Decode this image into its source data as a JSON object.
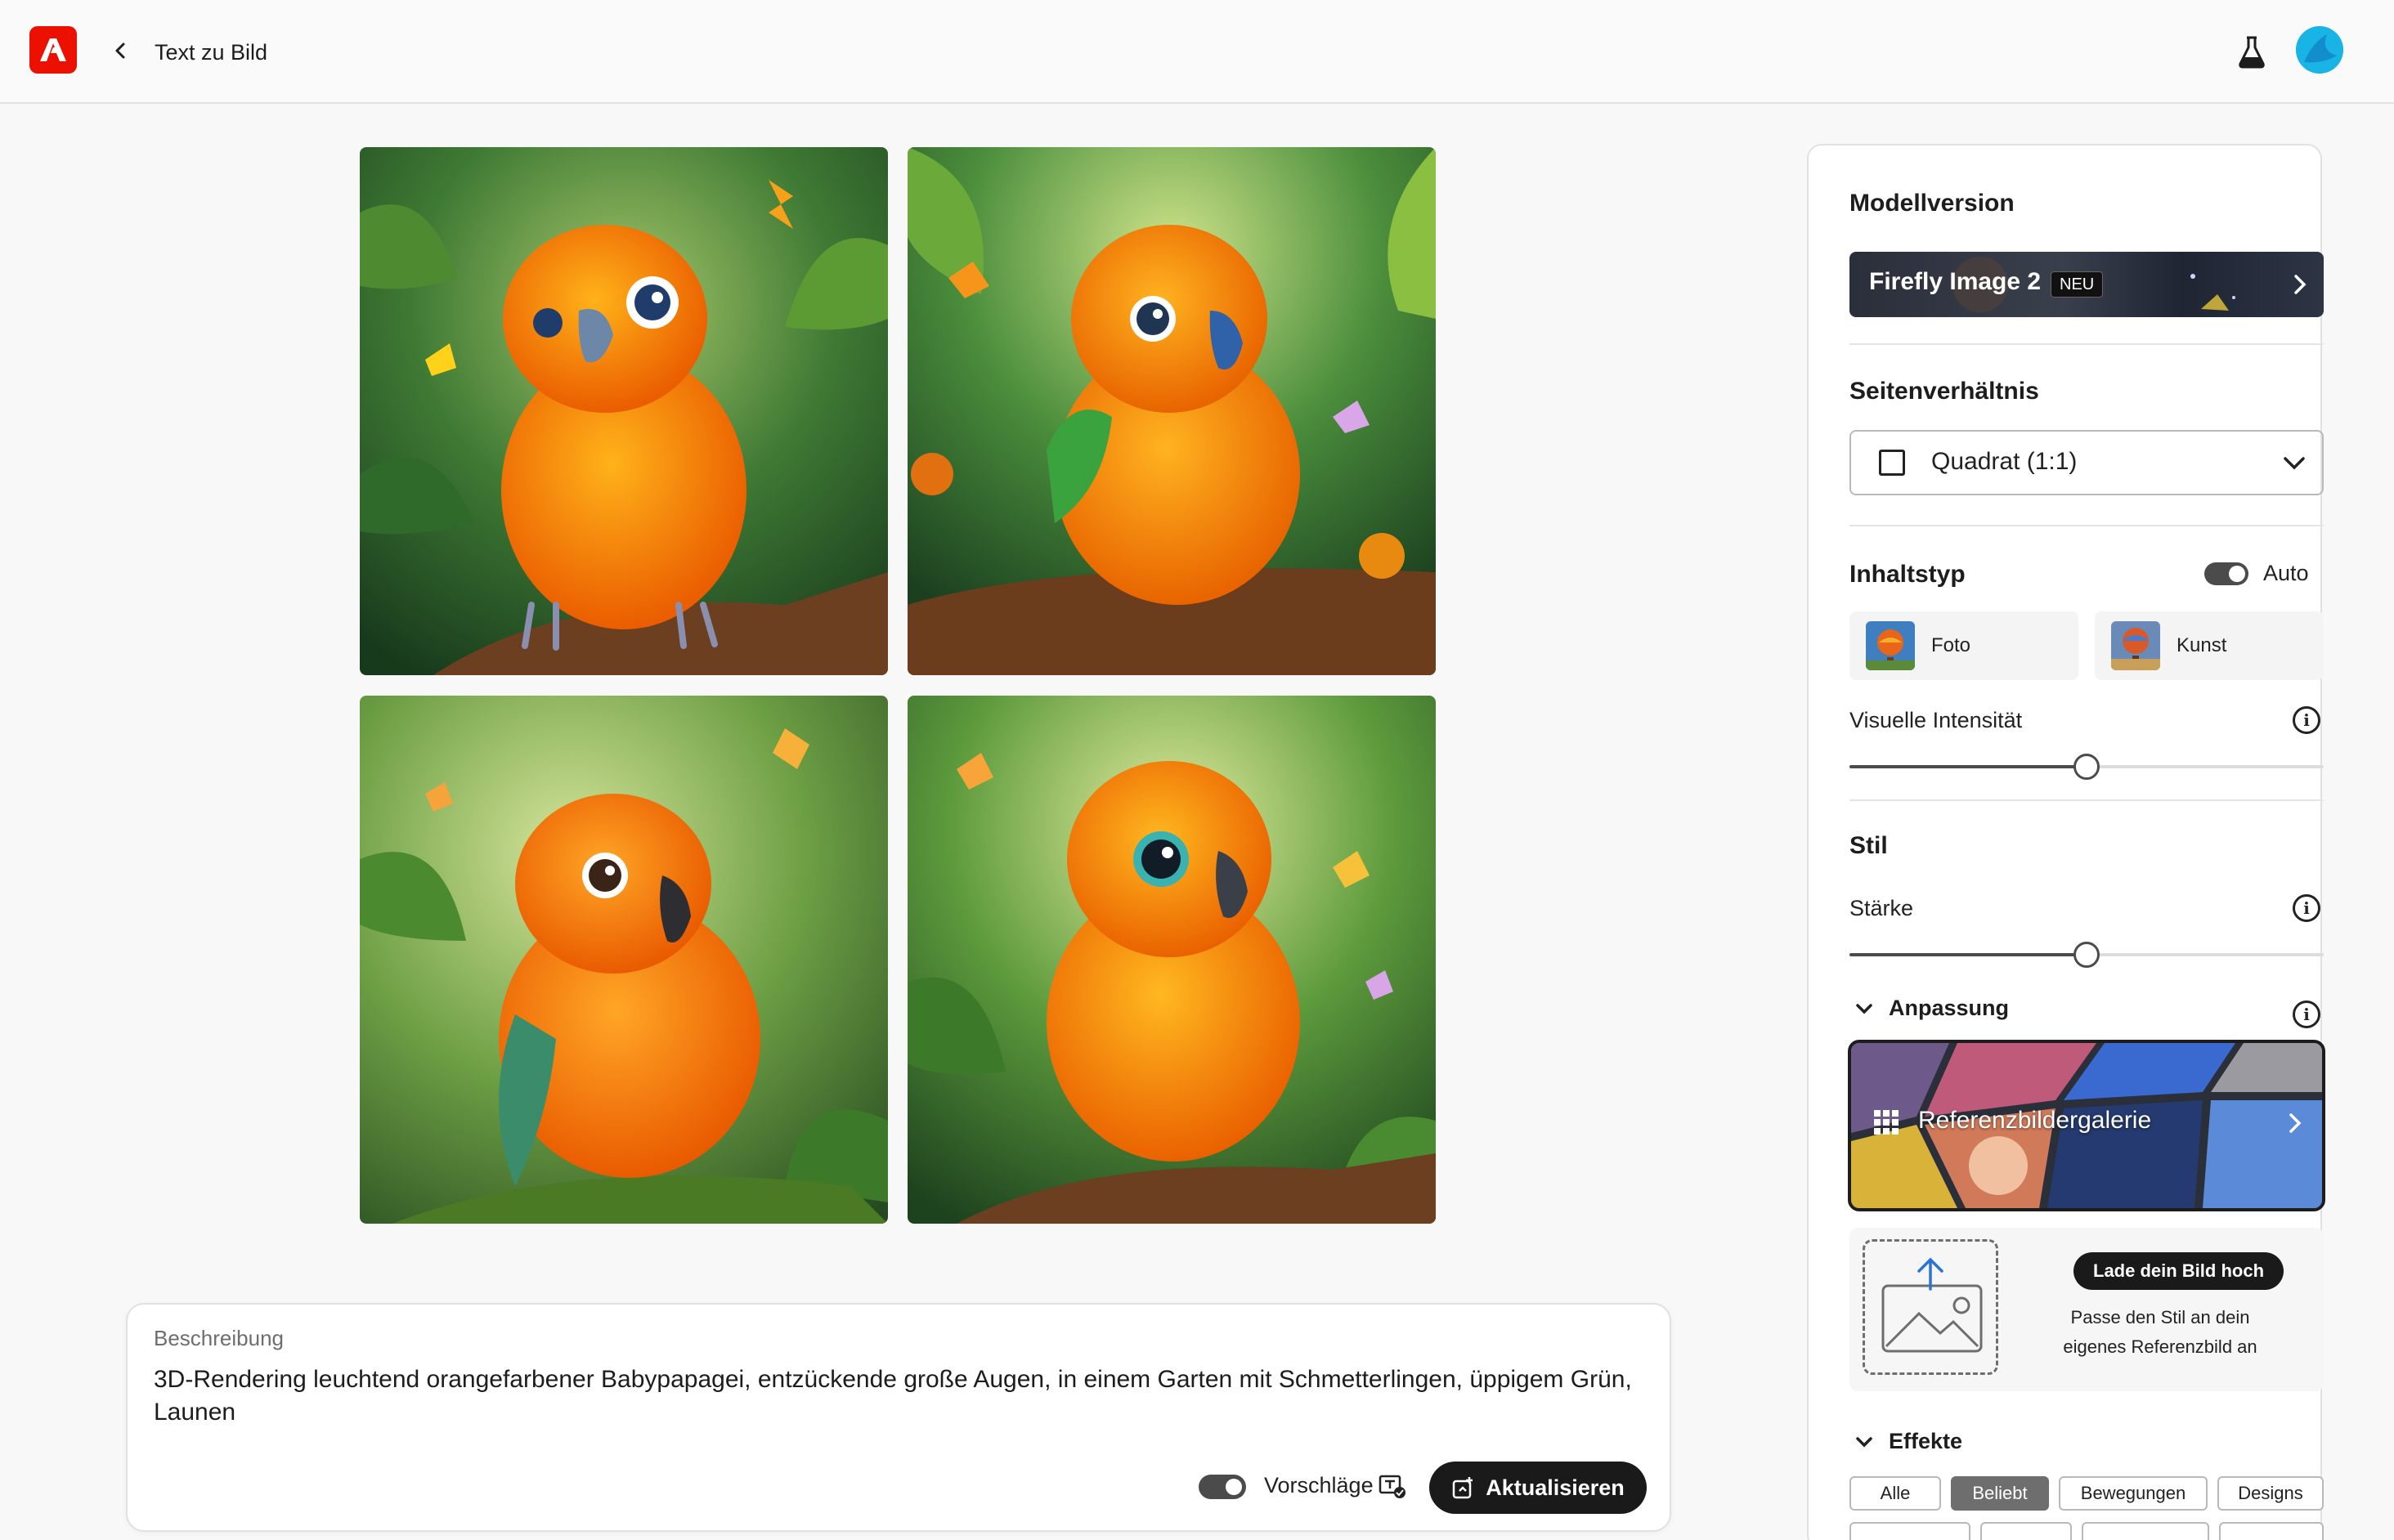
{
  "header": {
    "title": "Text zu Bild",
    "logo_icon": "adobe-logo",
    "labs_icon": "flask-icon",
    "back_icon": "chevron-left-icon"
  },
  "gallery": {
    "images": [
      {
        "subject": "orange parrot"
      },
      {
        "subject": "orange parrot"
      },
      {
        "subject": "orange parrot"
      },
      {
        "subject": "orange parrot"
      }
    ]
  },
  "prompt": {
    "label": "Beschreibung",
    "text": "3D-Rendering leuchtend orangefarbener Babypapagei, entzückende große Augen, in einem Garten mit Schmetterlingen, üppigem Grün, Launen",
    "suggestions_label": "Vorschläge",
    "update_label": "Aktualisieren"
  },
  "settings": {
    "model": {
      "heading": "Modellversion",
      "name": "Firefly Image 2",
      "badge": "NEU"
    },
    "aspect": {
      "heading": "Seitenverhältnis",
      "value": "Quadrat (1:1)"
    },
    "content_type": {
      "heading": "Inhaltstyp",
      "auto_label": "Auto",
      "options": [
        "Foto",
        "Kunst"
      ]
    },
    "visual_intensity": {
      "label": "Visuelle Intensität",
      "value": 0.5
    },
    "style": {
      "heading": "Stil",
      "strength_label": "Stärke",
      "strength_value": 0.5,
      "customization_label": "Anpassung",
      "gallery_label": "Referenzbildergalerie",
      "upload_button": "Lade dein Bild hoch",
      "upload_desc": "Passe den Stil an dein eigenes Referenzbild an"
    },
    "effects": {
      "heading": "Effekte",
      "tabs": [
        "Alle",
        "Beliebt",
        "Bewegungen",
        "Designs"
      ],
      "active_tab": "Beliebt"
    }
  },
  "colors": {
    "accent": "#eb1000",
    "avatar": "#19b4e6",
    "dark_button": "#1a1a1a"
  }
}
